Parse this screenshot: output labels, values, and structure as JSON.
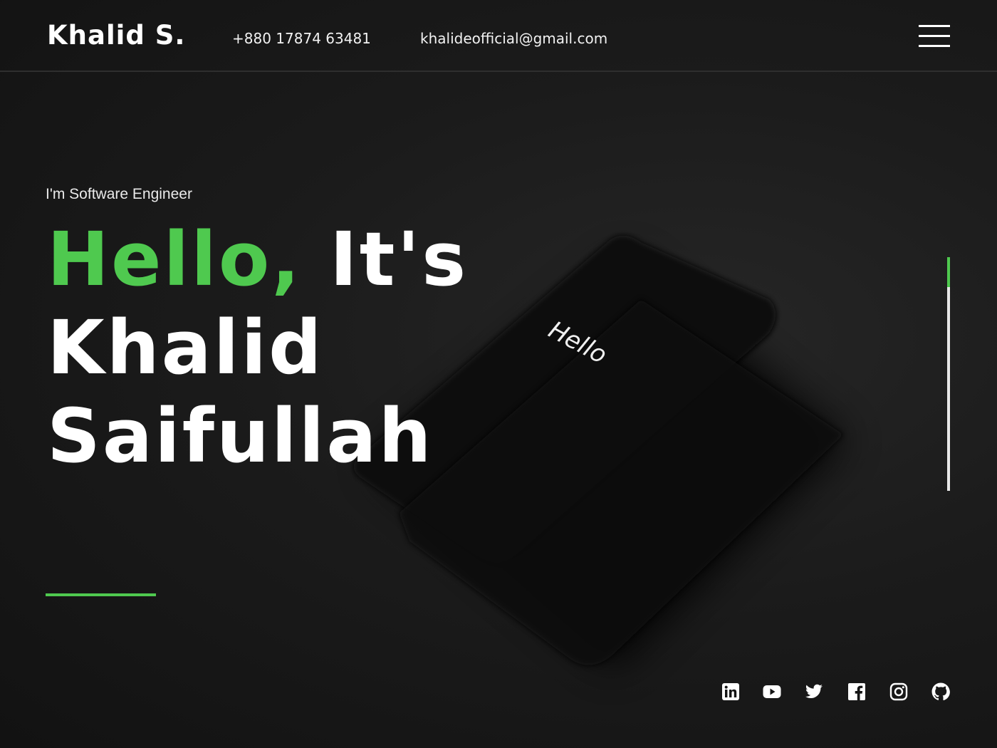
{
  "header": {
    "logo": "Khalid S.",
    "phone": "+880 17874 63481",
    "email": "khalideofficial@gmail.com"
  },
  "hero": {
    "subtitle": "I'm Software Engineer",
    "title_accent": "Hello,",
    "title_rest": "It's",
    "title_line2": "Khalid",
    "title_line3": "Saifullah"
  },
  "background": {
    "phone_screen_text": "Hello"
  },
  "social_icons": [
    "linkedin-icon",
    "youtube-icon",
    "twitter-icon",
    "facebook-icon",
    "instagram-icon",
    "github-icon"
  ],
  "colors": {
    "accent": "#4fc94f",
    "background": "#151515",
    "text": "#ffffff"
  }
}
